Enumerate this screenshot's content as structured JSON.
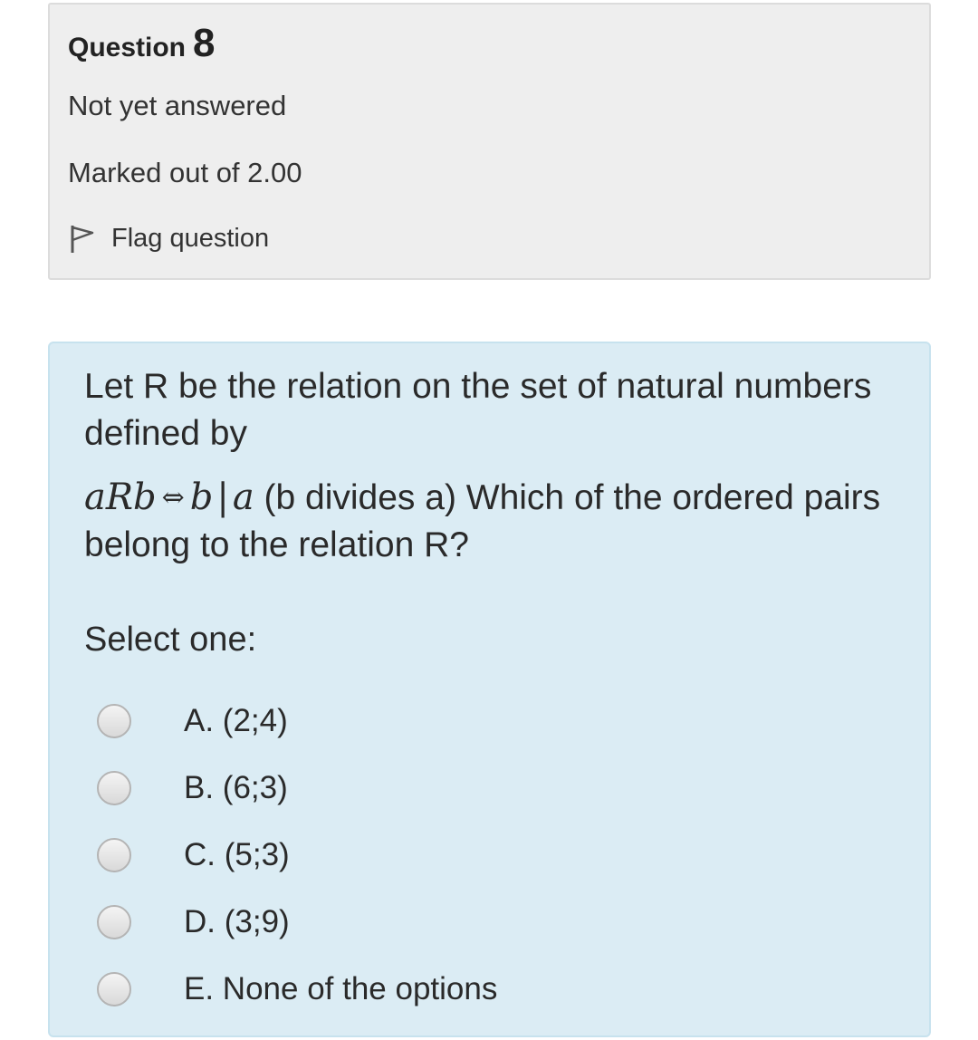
{
  "info": {
    "question_label": "Question",
    "question_number": "8",
    "state": "Not yet answered",
    "grade": "Marked out of 2.00",
    "flag_label": "Flag question"
  },
  "question": {
    "text_line1": "Let R be the relation on the set of natural numbers defined by",
    "math": {
      "lhs": "aRb",
      "iff": "⇔",
      "b": "b",
      "bar": "|",
      "a": "a"
    },
    "text_line2": " (b divides a)  Which of the ordered pairs belong to the relation R?",
    "prompt": "Select one:"
  },
  "answers": [
    {
      "label": "A. (2;4)",
      "selected": false
    },
    {
      "label": "B. (6;3)",
      "selected": false
    },
    {
      "label": "C. (5;3)",
      "selected": false
    },
    {
      "label": "D. (3;9)",
      "selected": false
    },
    {
      "label": "E. None of the options",
      "selected": false
    }
  ],
  "colors": {
    "info_background": "#eeeeee",
    "content_background": "#dbecf4"
  },
  "icons": {
    "flag": "flag-icon"
  }
}
